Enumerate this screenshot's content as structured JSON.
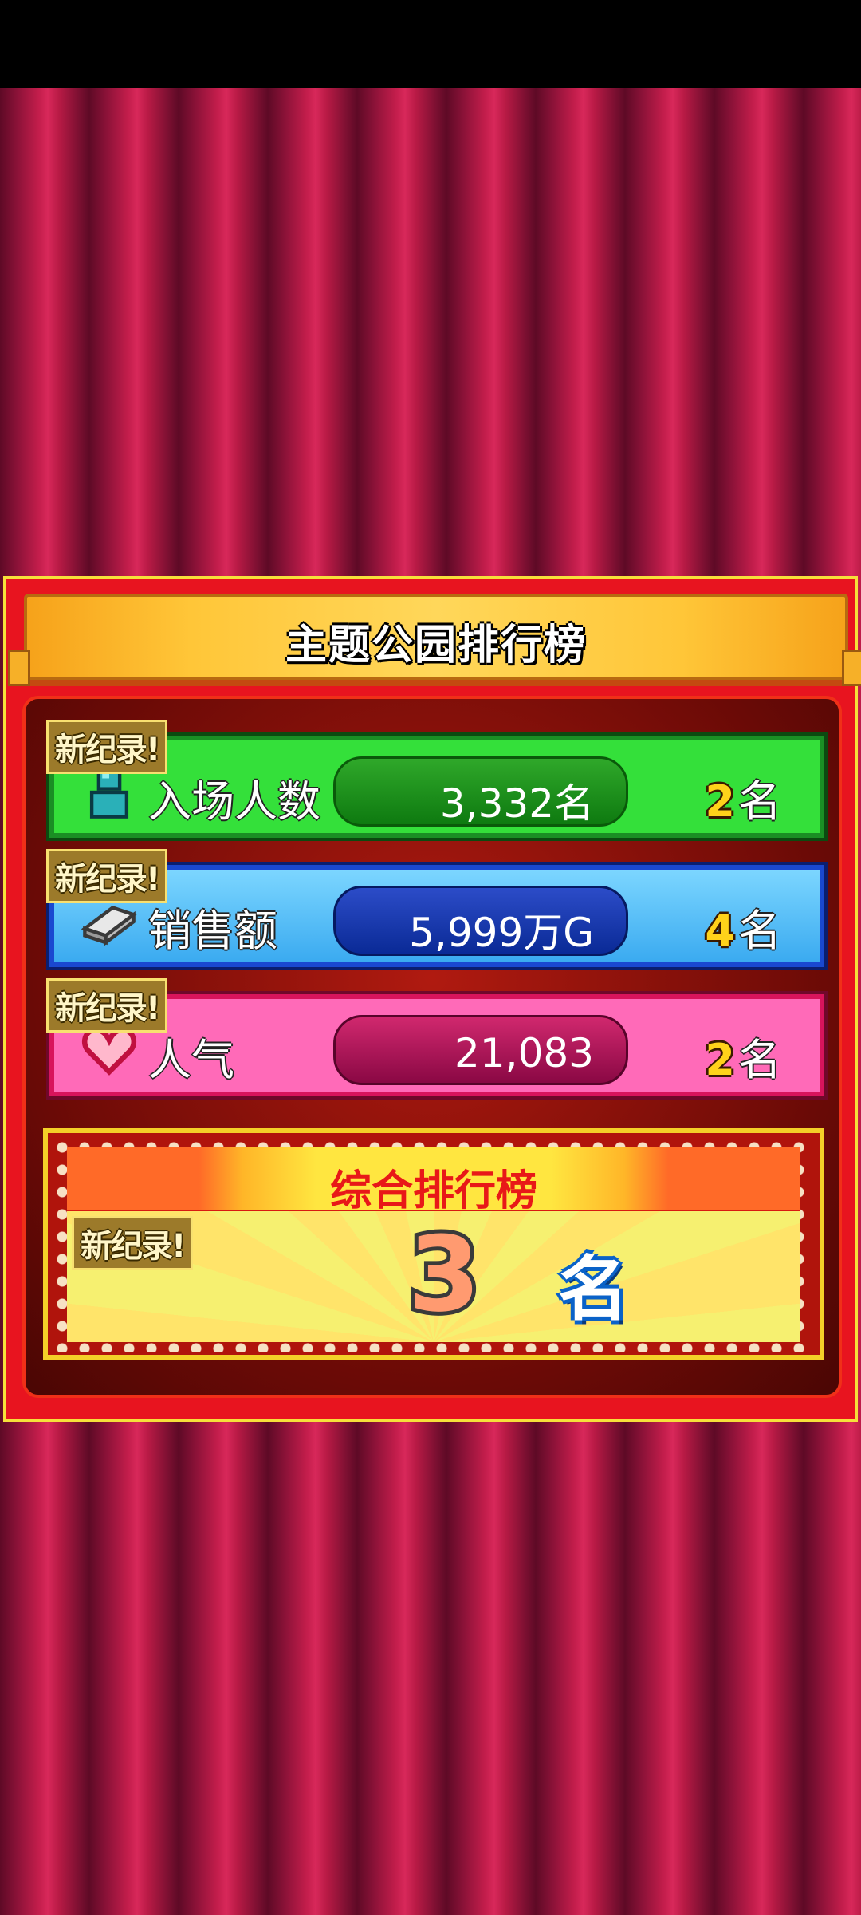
{
  "title": "主题公园排行榜",
  "badge": "新纪录!",
  "rows": [
    {
      "label": "入场人数",
      "value": "3,332名",
      "rank_num": "2",
      "rank_suffix": "名",
      "icon": "person-icon",
      "new_record": true
    },
    {
      "label": "销售额",
      "value": "5,999万G",
      "rank_num": "4",
      "rank_suffix": "名",
      "icon": "money-icon",
      "new_record": true
    },
    {
      "label": "人气",
      "value": "21,083",
      "rank_num": "2",
      "rank_suffix": "名",
      "icon": "heart-icon",
      "new_record": true
    }
  ],
  "overall": {
    "title": "综合排行榜",
    "rank_num": "3",
    "rank_suffix": "名",
    "new_record": true
  },
  "colors": {
    "green": "#34e03a",
    "blue": "#3aaaf0",
    "pink": "#ff6ab8",
    "panel": "#e8141f",
    "gold": "#ffd21a"
  }
}
